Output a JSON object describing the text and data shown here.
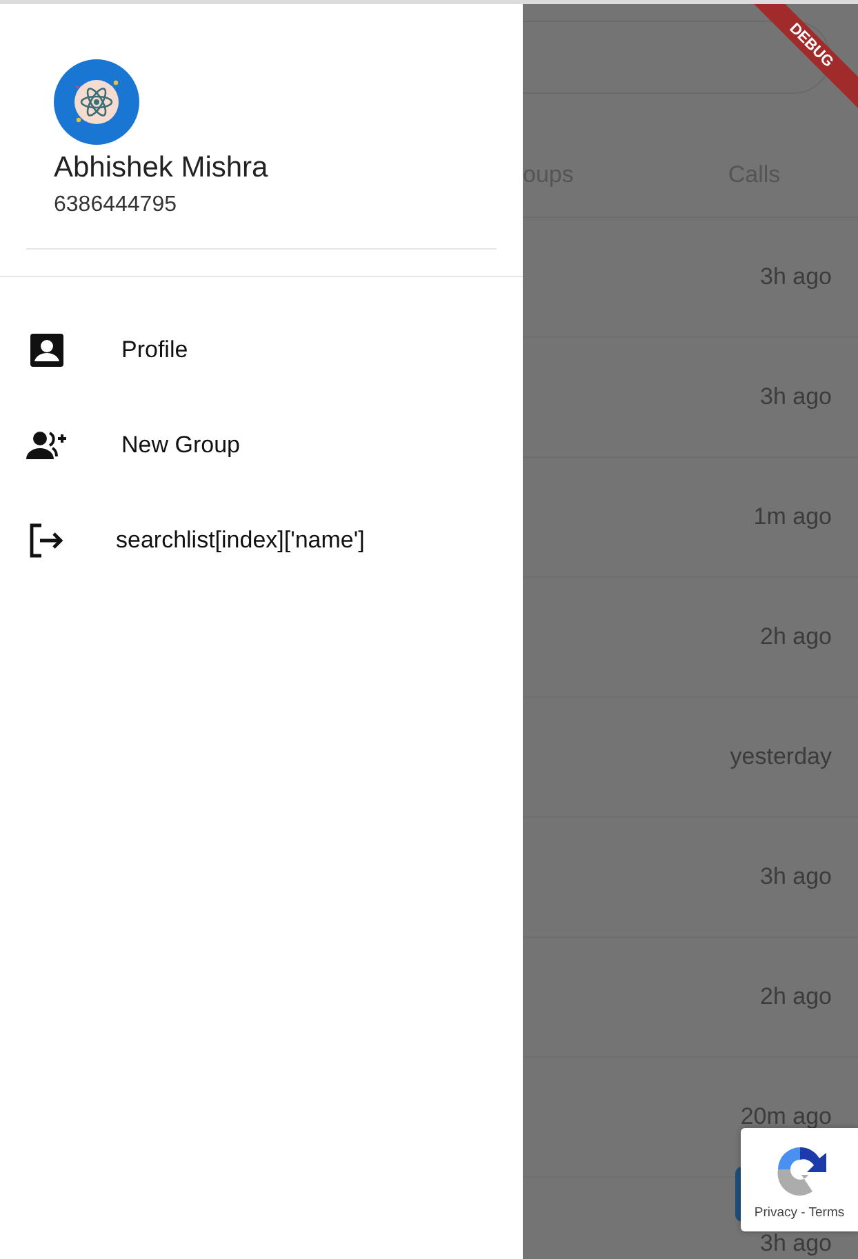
{
  "drawer": {
    "header": {
      "name": "Abhishek Mishra",
      "phone": "6386444795"
    },
    "items": [
      {
        "kind": "profile",
        "label": "Profile"
      },
      {
        "kind": "group-add",
        "label": "New Group"
      },
      {
        "kind": "logout",
        "label": "searchlist[index]['name']"
      }
    ]
  },
  "background": {
    "tabs": [
      "oups",
      "Calls"
    ],
    "times": [
      "3h ago",
      "3h ago",
      "1m ago",
      "2h ago",
      "yesterday",
      "3h ago",
      "2h ago",
      "20m ago",
      "3h ago"
    ]
  },
  "debug_banner": "DEBUG",
  "recaptcha": {
    "links": "Privacy - Terms"
  }
}
